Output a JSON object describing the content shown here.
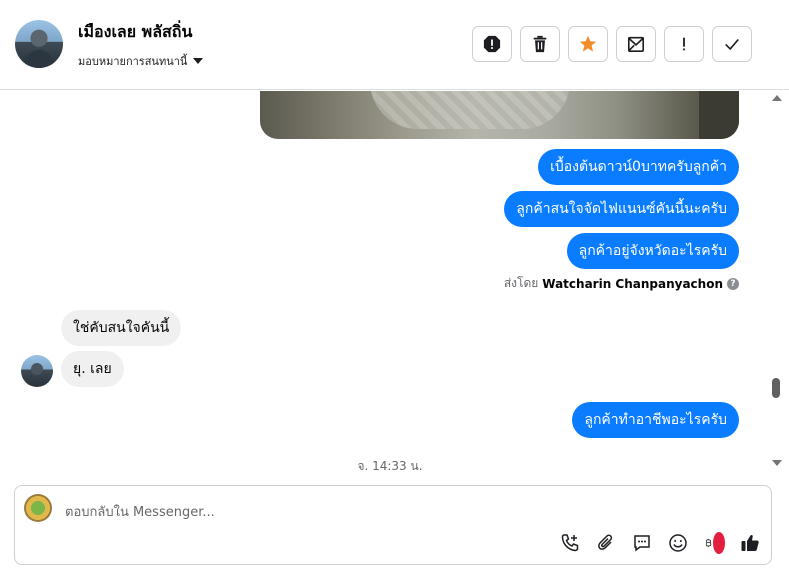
{
  "header": {
    "contact_name": "เมืองเลย พลัสถิ่น",
    "assign_label": "มอบหมายการสนทนานี้",
    "toolbar": [
      {
        "name": "report-spam-icon"
      },
      {
        "name": "trash-icon"
      },
      {
        "name": "star-icon",
        "color": "#f28c28"
      },
      {
        "name": "mark-unread-icon"
      },
      {
        "name": "follow-up-icon"
      },
      {
        "name": "done-check-icon"
      }
    ]
  },
  "messages": {
    "out1": "เบื้องต้นดาวน์0บาทครับลูกค้า",
    "out2": "ลูกค้าสนใจจัดไฟแนนซ์คันนี้นะครับ",
    "out3": "ลูกค้าอยู่จังหวัดอะไรครับ",
    "sent_by_prefix": "ส่งโดย",
    "sent_by_name": "Watcharin Chanpanyachon",
    "in1": "ใช่คับสนใจคันนี้",
    "in2": "ยุ. เลย",
    "out4": "ลูกค้าทำอาชีพอะไรครับ",
    "timestamp": "จ. 14:33 น."
  },
  "composer": {
    "placeholder": "ตอบกลับใน Messenger..."
  },
  "colors": {
    "outgoing_bubble": "#0a7cff",
    "incoming_bubble": "#f0f0f0",
    "star": "#f28c28"
  }
}
